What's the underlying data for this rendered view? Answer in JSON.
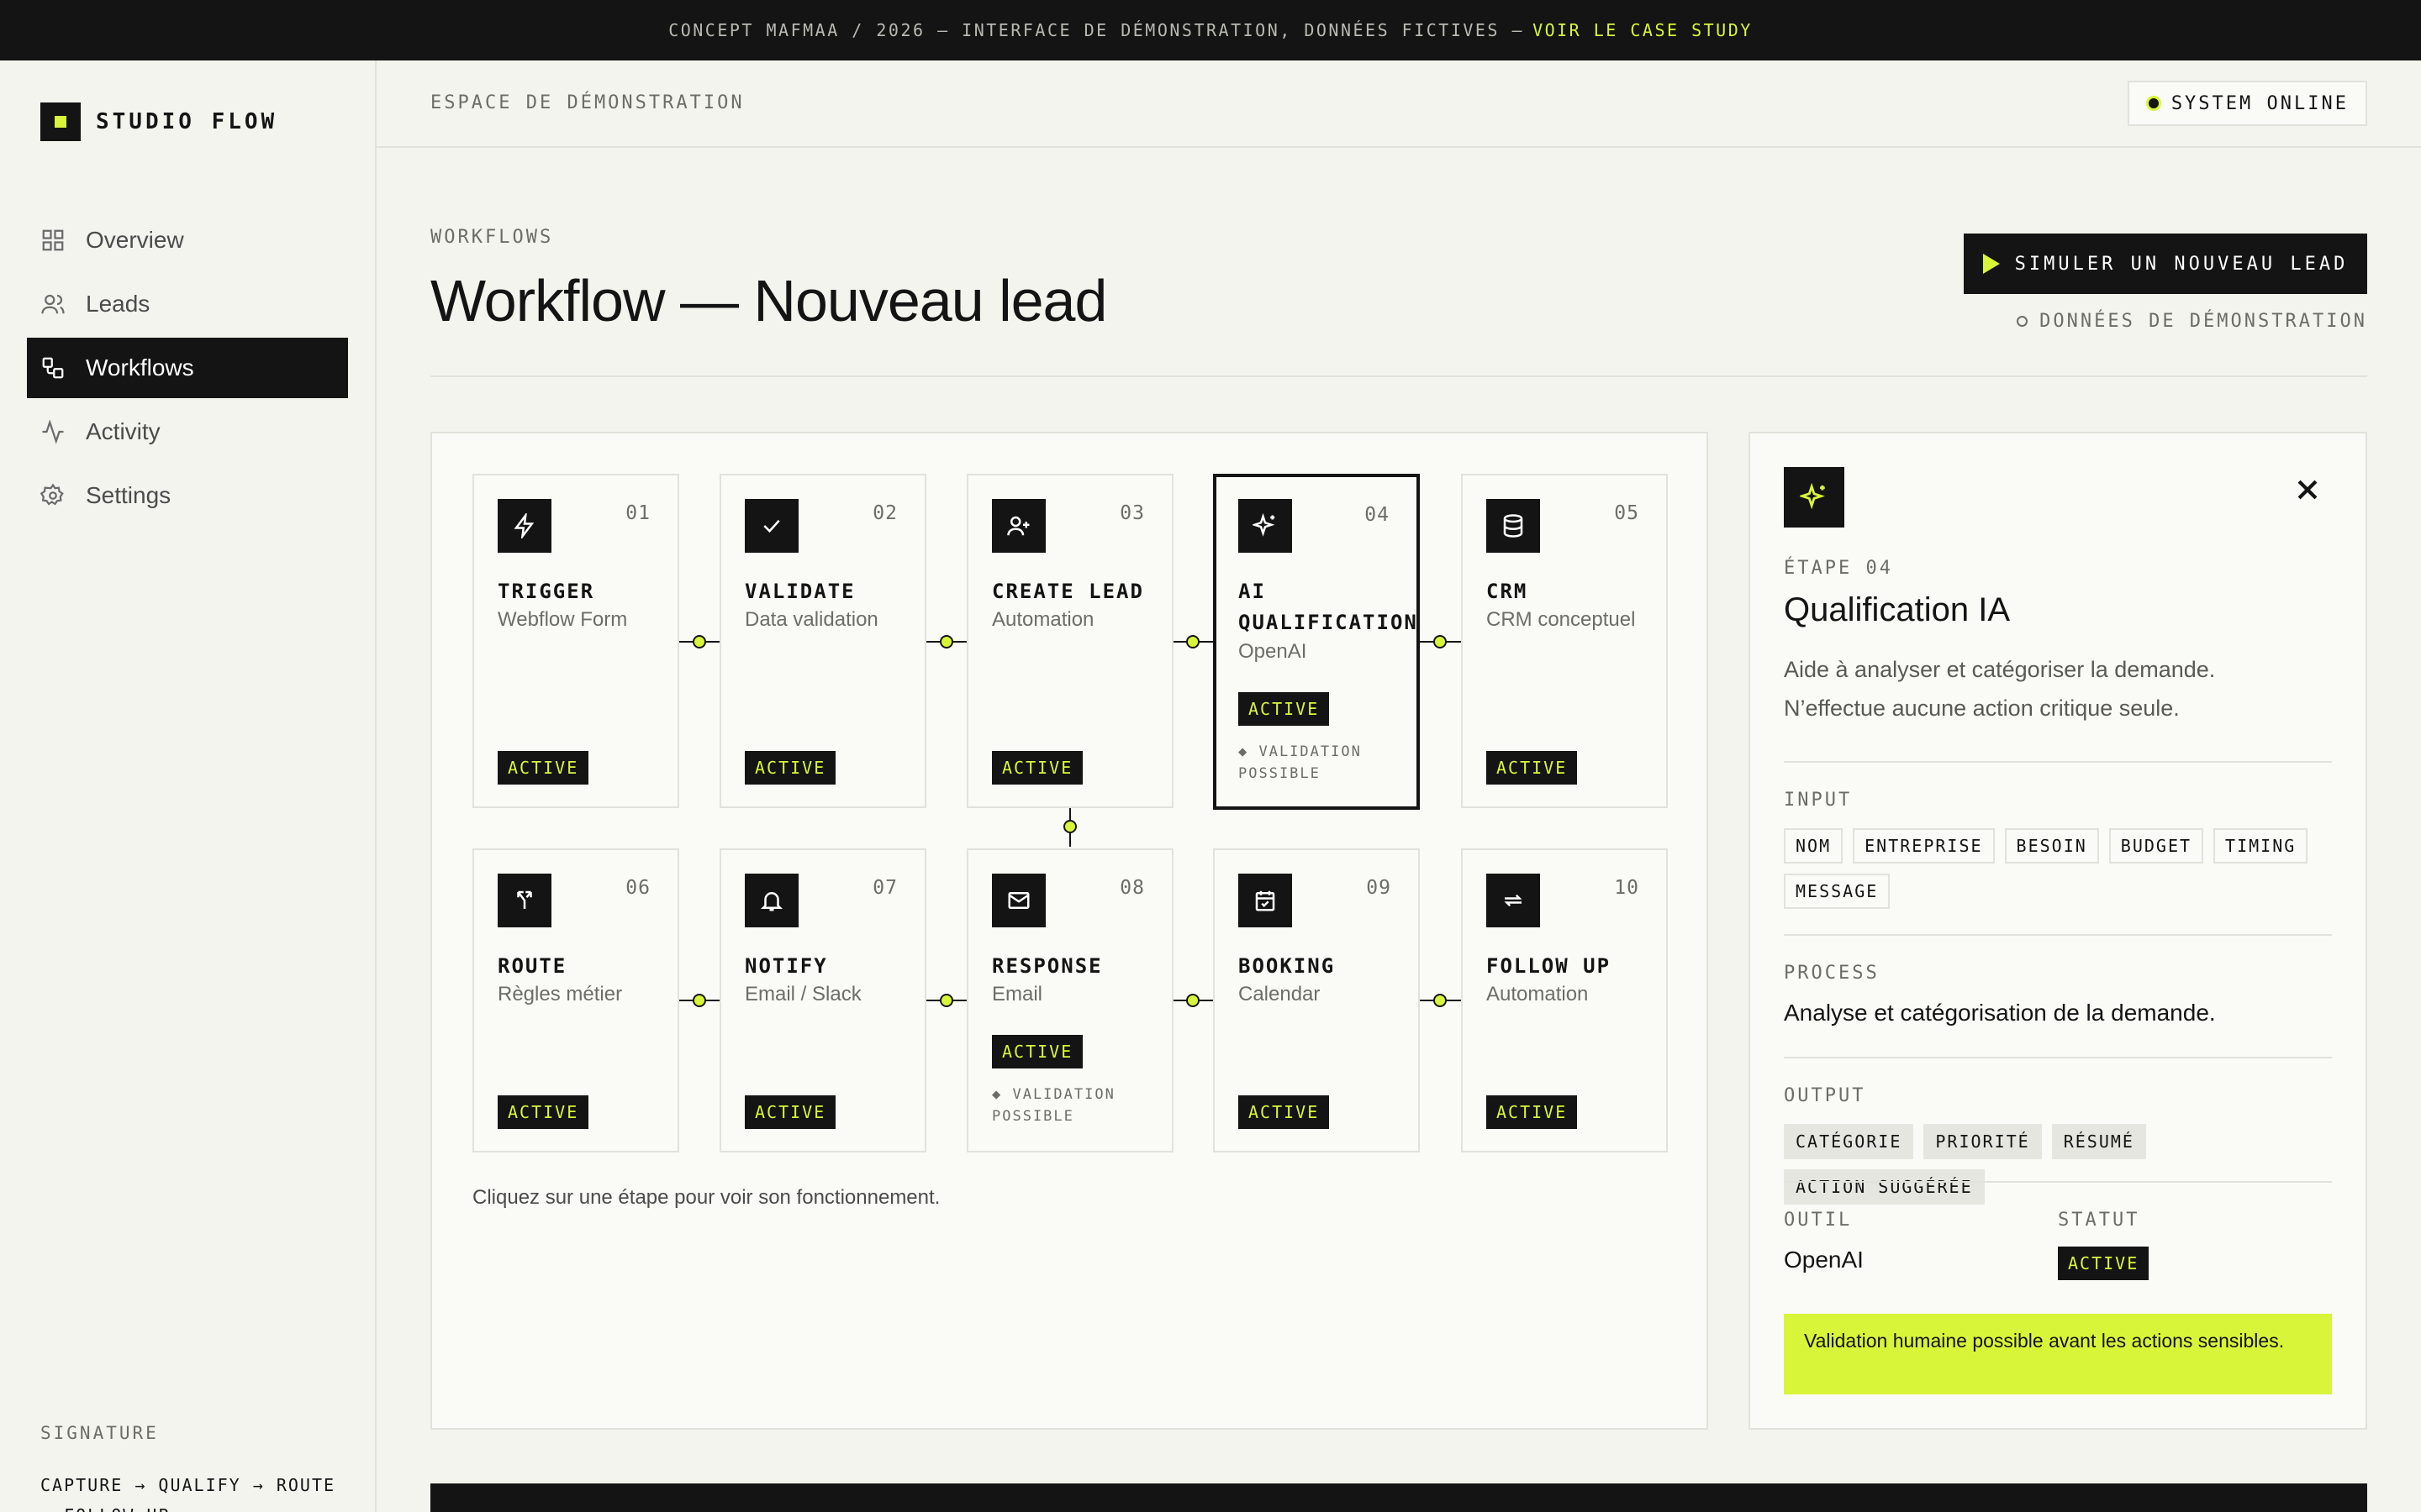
{
  "banner": {
    "text": "CONCEPT MAFMAA / 2026 — INTERFACE DE DÉMONSTRATION, DONNÉES FICTIVES —",
    "link": "VOIR LE CASE STUDY"
  },
  "brand": {
    "name": "STUDIO FLOW"
  },
  "sidebar": {
    "items": [
      {
        "label": "Overview",
        "icon": "grid-icon"
      },
      {
        "label": "Leads",
        "icon": "users-icon"
      },
      {
        "label": "Workflows",
        "icon": "workflow-icon",
        "active": true
      },
      {
        "label": "Activity",
        "icon": "activity-icon"
      },
      {
        "label": "Settings",
        "icon": "gear-icon"
      }
    ],
    "signature_label": "SIGNATURE",
    "signature_value": "CAPTURE → QUALIFY → ROUTE → FOLLOW UP"
  },
  "header": {
    "crumb": "ESPACE DE DÉMONSTRATION",
    "status": "SYSTEM ONLINE"
  },
  "page": {
    "eyebrow": "WORKFLOWS",
    "title": "Workflow — Nouveau lead",
    "simulate_button": "SIMULER UN NOUVEAU LEAD",
    "demo_note": "DONNÉES DE DÉMONSTRATION"
  },
  "workflow": {
    "hint": "Cliquez sur une étape pour voir son fonctionnement.",
    "steps": [
      {
        "num": "01",
        "name": "TRIGGER",
        "sub": "Webflow Form",
        "badge": "ACTIVE",
        "icon": "bolt-icon"
      },
      {
        "num": "02",
        "name": "VALIDATE",
        "sub": "Data validation",
        "badge": "ACTIVE",
        "icon": "check-icon"
      },
      {
        "num": "03",
        "name": "CREATE LEAD",
        "sub": "Automation",
        "badge": "ACTIVE",
        "icon": "user-plus-icon"
      },
      {
        "num": "04",
        "name": "AI QUALIFICATION",
        "sub": "OpenAI",
        "badge": "ACTIVE",
        "note": "◆ VALIDATION POSSIBLE",
        "icon": "sparkles-icon",
        "selected": true
      },
      {
        "num": "05",
        "name": "CRM",
        "sub": "CRM conceptuel",
        "badge": "ACTIVE",
        "icon": "database-icon"
      },
      {
        "num": "06",
        "name": "ROUTE",
        "sub": "Règles métier",
        "badge": "ACTIVE",
        "icon": "split-icon"
      },
      {
        "num": "07",
        "name": "NOTIFY",
        "sub": "Email / Slack",
        "badge": "ACTIVE",
        "icon": "bell-icon"
      },
      {
        "num": "08",
        "name": "RESPONSE",
        "sub": "Email",
        "badge": "ACTIVE",
        "note": "◆ VALIDATION POSSIBLE",
        "icon": "mail-icon"
      },
      {
        "num": "09",
        "name": "BOOKING",
        "sub": "Calendar",
        "badge": "ACTIVE",
        "icon": "calendar-icon"
      },
      {
        "num": "10",
        "name": "FOLLOW UP",
        "sub": "Automation",
        "badge": "ACTIVE",
        "icon": "repeat-icon"
      }
    ]
  },
  "detail": {
    "eyebrow": "ÉTAPE 04",
    "title": "Qualification IA",
    "description": "Aide à analyser et catégoriser la demande. N’effectue aucune action critique seule.",
    "input_label": "INPUT",
    "inputs": [
      "NOM",
      "ENTREPRISE",
      "BESOIN",
      "BUDGET",
      "TIMING",
      "MESSAGE"
    ],
    "process_label": "PROCESS",
    "process": "Analyse et catégorisation de la demande.",
    "output_label": "OUTPUT",
    "outputs": [
      "CATÉGORIE",
      "PRIORITÉ",
      "RÉSUMÉ",
      "ACTION SUGGÉRÉE"
    ],
    "tool_label": "OUTIL",
    "tool": "OpenAI",
    "status_label": "STATUT",
    "status": "ACTIVE",
    "callout": "Validation humaine possible avant les actions sensibles."
  }
}
